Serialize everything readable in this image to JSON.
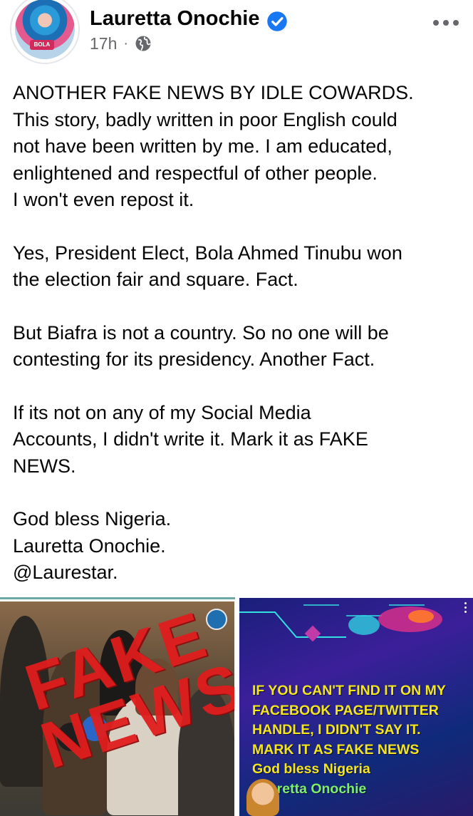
{
  "post": {
    "author": "Lauretta Onochie",
    "time": "17h",
    "separator": "·",
    "audience_icon": "globe-icon",
    "more_icon": "more-horizontal-icon",
    "avatar_badge": "BOLA",
    "paragraphs": [
      "ANOTHER FAKE NEWS BY IDLE COWARDS.\nThis story, badly written in poor English could\nnot have been written by me. I am educated,\nenlightened and respectful of other people.\nI won't even repost it.",
      "Yes, President Elect, Bola Ahmed Tinubu won\nthe election fair and square. Fact.",
      "But Biafra is not a country. So no one will be\ncontesting for its presidency. Another Fact.",
      "If its not on any of my Social Media\nAccounts, I didn't write it. Mark it as FAKE\nNEWS.",
      "God bless Nigeria.\nLauretta Onochie.\n@Laurestar."
    ]
  },
  "media": {
    "left": {
      "stamp_line1": "FAKE",
      "stamp_line2": "NEWS"
    },
    "right": {
      "lines": [
        "IF YOU CAN'T FIND IT ON MY",
        "FACEBOOK PAGE/TWITTER",
        "HANDLE, I DIDN'T SAY IT.",
        "MARK IT AS  FAKE NEWS",
        "God bless Nigeria",
        "Lauretta Onochie"
      ]
    }
  },
  "colors": {
    "verified_blue": "#1877f2",
    "meta_gray": "#65676b",
    "stamp_red": "#e11d1d",
    "neon_yellow": "#f3e61e"
  }
}
